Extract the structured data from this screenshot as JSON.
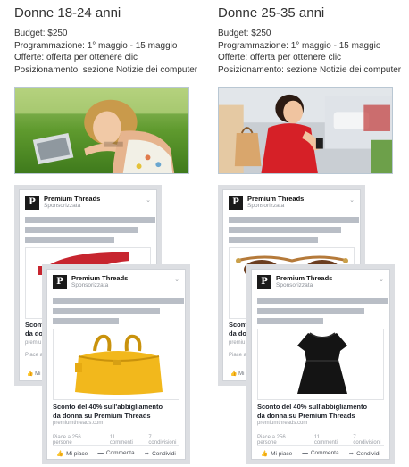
{
  "columns": [
    {
      "title": "Donne 18-24 anni",
      "info": [
        "Budget: $250",
        "Programmazione: 1° maggio - 15 maggio",
        "Offerte: offerta per ottenere clic",
        "Posizionamento: sezione Notizie dei computer"
      ]
    },
    {
      "title": "Donne 25-35 anni",
      "info": [
        "Budget: $250",
        "Programmazione: 1° maggio - 15 maggio",
        "Offerte: offerta per ottenere clic",
        "Posizionamento: sezione Notizie dei computer"
      ]
    }
  ],
  "ad": {
    "logo_letter": "P",
    "brand": "Premium Threads",
    "sponsored": "Sponsorizzata",
    "caption_line1": "Sconto del 40% sull'abbigliamento",
    "caption_line2": "da donna su Premium Threads",
    "caption_clip_line1": "Sconto",
    "caption_clip_line2": "da do",
    "url": "premiumthreads.com",
    "url_clip": "premiu",
    "stats_likes": "Piace a 256 persone",
    "stats_comments": "11 commenti",
    "stats_shares": "7 condivisioni",
    "stats_clip": "Piace a",
    "like_label": "Mi piace",
    "comment_label": "Commenta",
    "share_label": "Condividi",
    "chevron": "⌄"
  }
}
